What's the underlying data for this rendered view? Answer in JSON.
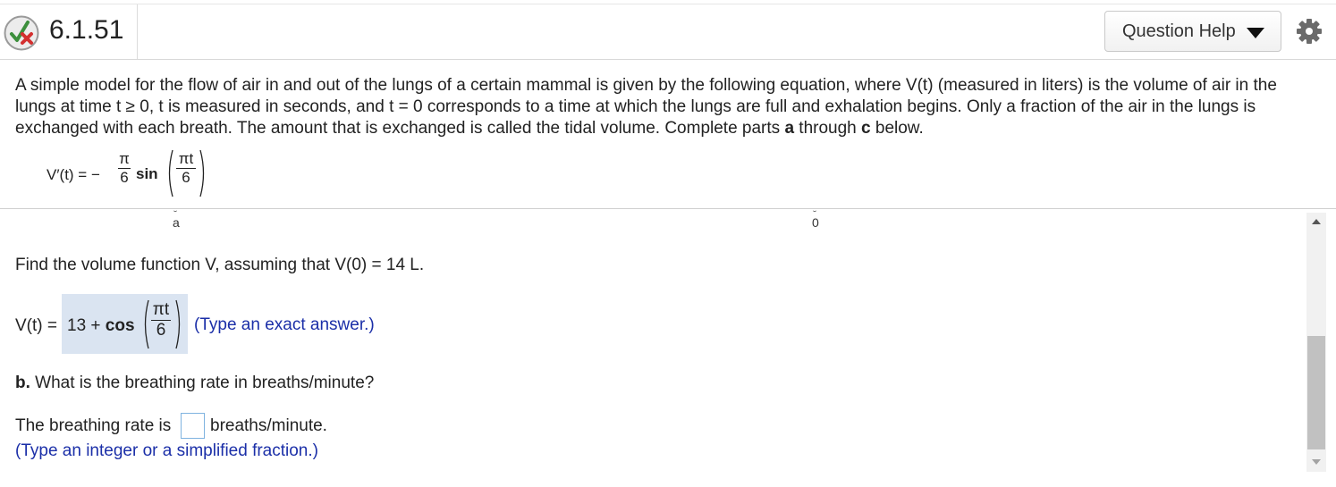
{
  "header": {
    "question_number": "6.1.51",
    "help_button_label": "Question Help",
    "status_icon": "partial-correct-icon",
    "settings_icon": "gear-icon"
  },
  "problem": {
    "intro": "A simple model for the flow of air in and out of the lungs of a certain mammal is given by the following equation, where V(t) (measured in liters) is the volume of air in the lungs at time t ≥ 0,  t is measured in seconds, and t = 0 corresponds to a time at which the lungs are full and exhalation begins. Only a fraction of the air in the lungs is exchanged with each breath. The amount that is exchanged is called the tidal volume. Complete parts",
    "part_a_bold": "a",
    "through": " through ",
    "part_c_bold": "c",
    "below": " below.",
    "equation": {
      "lhs": "V′(t) =",
      "minus": "−",
      "coef_num": "π",
      "coef_den": "6",
      "func": "sin",
      "arg_num": "πt",
      "arg_den": "6"
    }
  },
  "scroll_labels": {
    "left": "a",
    "right": "0"
  },
  "part_a": {
    "prompt": "Find the volume function V, assuming that V(0) = 14 L.",
    "answer_lhs": "V(t) =",
    "answer_const": "13 +",
    "answer_func": "cos",
    "answer_arg_num": "πt",
    "answer_arg_den": "6",
    "hint": "(Type an exact answer.)"
  },
  "part_b": {
    "label": "b.",
    "prompt": " What is the breathing rate in breaths/minute?",
    "answer_prefix": "The breathing rate is",
    "answer_value": "",
    "answer_suffix": "breaths/minute.",
    "hint": "(Type an integer or a simplified fraction.)"
  },
  "colors": {
    "answer_highlight": "#dae4f1",
    "hint_text": "#1b2fa8",
    "input_border": "#7fb3e0",
    "status_check": "#3c8f3c",
    "status_x": "#d32f2f"
  }
}
